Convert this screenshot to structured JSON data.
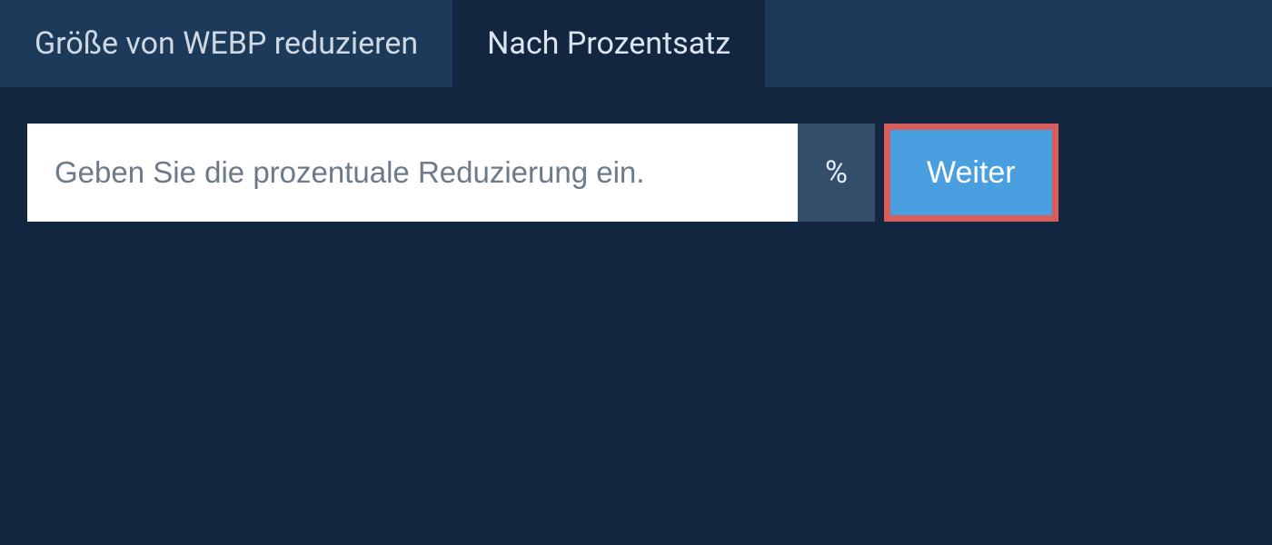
{
  "tabs": [
    {
      "label": "Größe von WEBP reduzieren",
      "active": false
    },
    {
      "label": "Nach Prozentsatz",
      "active": true
    }
  ],
  "input": {
    "placeholder": "Geben Sie die prozentuale Reduzierung ein.",
    "value": "",
    "unit": "%"
  },
  "submit": {
    "label": "Weiter"
  }
}
